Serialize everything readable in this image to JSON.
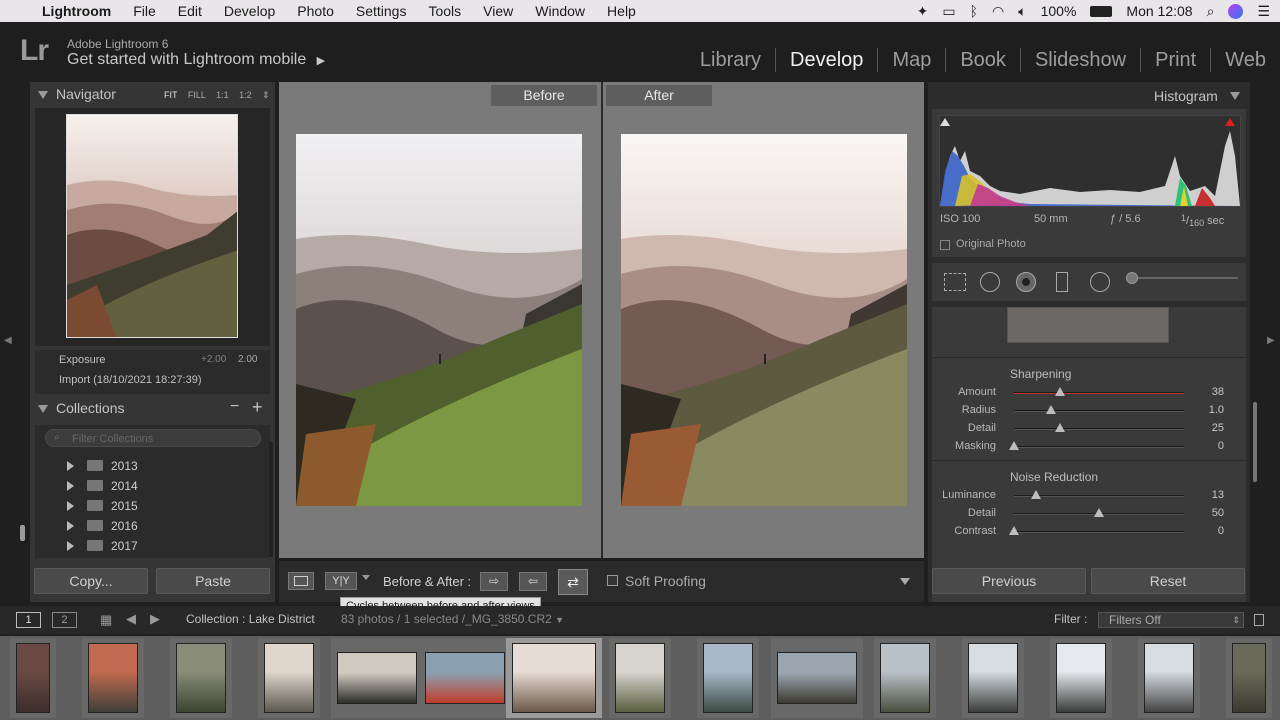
{
  "menubar": {
    "app": "Lightroom",
    "items": [
      "File",
      "Edit",
      "Develop",
      "Photo",
      "Settings",
      "Tools",
      "View",
      "Window",
      "Help"
    ],
    "battery": "100%",
    "clock": "Mon 12:08"
  },
  "top": {
    "logo": "Lr",
    "brand_line1": "Adobe Lightroom 6",
    "brand_line2": "Get started with Lightroom mobile",
    "modules": [
      "Library",
      "Develop",
      "Map",
      "Book",
      "Slideshow",
      "Print",
      "Web"
    ],
    "active_module": "Develop"
  },
  "navigator": {
    "title": "Navigator",
    "zoom_options": [
      "FIT",
      "FILL",
      "1:1",
      "1:2"
    ]
  },
  "history": {
    "exposure_label": "Exposure",
    "exposure_change": "+2.00",
    "exposure_value": "2.00",
    "import_label": "Import (18/10/2021 18:27:39)"
  },
  "collections": {
    "title": "Collections",
    "minus": "−",
    "plus": "+",
    "filter_placeholder": "Filter Collections",
    "items": [
      "2013",
      "2014",
      "2015",
      "2016",
      "2017"
    ]
  },
  "left_buttons": {
    "copy": "Copy...",
    "paste": "Paste"
  },
  "compare": {
    "before": "Before",
    "after": "After"
  },
  "toolbar": {
    "before_after_label": "Before & After :",
    "soft_proofing": "Soft Proofing",
    "yy": "Y|Y",
    "tooltip": "Cycles between before and after views"
  },
  "histogram": {
    "title": "Histogram",
    "iso": "ISO 100",
    "focal": "50 mm",
    "aperture": "ƒ / 5.6",
    "shutter_num": "1",
    "shutter_den": "160",
    "shutter_unit": "sec",
    "original_photo": "Original Photo"
  },
  "sharpening": {
    "title": "Sharpening",
    "sliders": [
      {
        "label": "Amount",
        "value": "38",
        "pos": 0.27
      },
      {
        "label": "Radius",
        "value": "1.0",
        "pos": 0.22
      },
      {
        "label": "Detail",
        "value": "25",
        "pos": 0.27
      },
      {
        "label": "Masking",
        "value": "0",
        "pos": 0.0
      }
    ]
  },
  "noise": {
    "title": "Noise Reduction",
    "sliders": [
      {
        "label": "Luminance",
        "value": "13",
        "pos": 0.13
      },
      {
        "label": "Detail",
        "value": "50",
        "pos": 0.5
      },
      {
        "label": "Contrast",
        "value": "0",
        "pos": 0.0
      }
    ]
  },
  "right_buttons": {
    "previous": "Previous",
    "reset": "Reset"
  },
  "filmbar": {
    "page1": "1",
    "page2": "2",
    "collection": "Collection : Lake District",
    "count": "83 photos / 1 selected /_MG_3850.CR2",
    "filter_label": "Filter :",
    "filter_value": "Filters Off"
  },
  "colors": {
    "panel": "#353535",
    "background": "#1e1e1e",
    "active_module": "#f0f0f0",
    "amount_track": "#c0392b"
  }
}
